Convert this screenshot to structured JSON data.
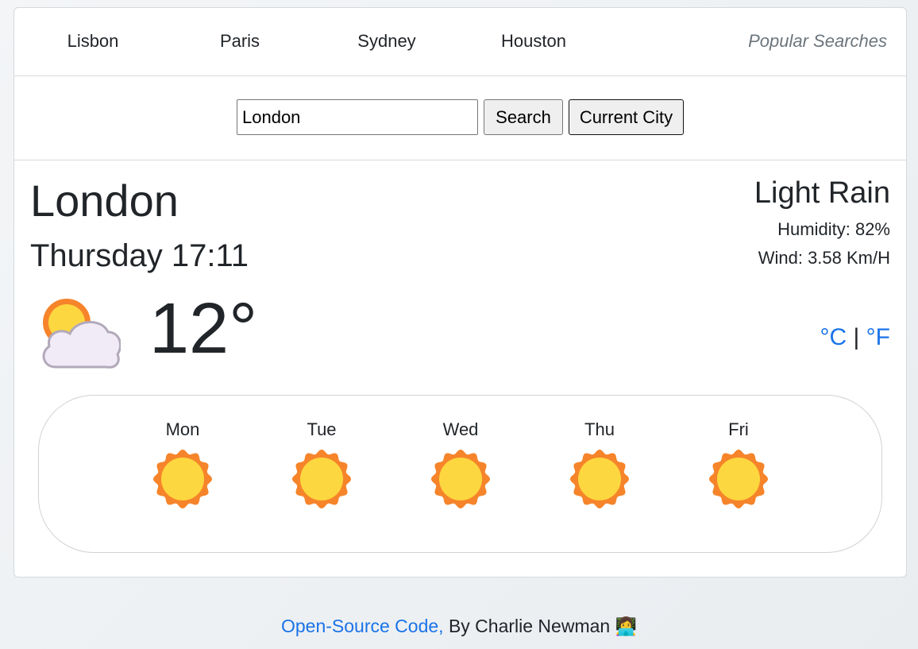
{
  "popular": {
    "cities": [
      "Lisbon",
      "Paris",
      "Sydney",
      "Houston"
    ],
    "title": "Popular Searches"
  },
  "search": {
    "value": "London",
    "search_label": "Search",
    "current_city_label": "Current City"
  },
  "current": {
    "city": "London",
    "datetime": "Thursday 17:11",
    "icon": "partly-cloudy-icon",
    "temperature": "12°",
    "description": "Light Rain",
    "humidity": "Humidity: 82%",
    "wind": "Wind: 3.58 Km/H",
    "unit_celsius": "°C",
    "unit_separator": "|",
    "unit_fahrenheit": "°F"
  },
  "forecast": [
    {
      "day": "Mon",
      "icon": "sun-icon"
    },
    {
      "day": "Tue",
      "icon": "sun-icon"
    },
    {
      "day": "Wed",
      "icon": "sun-icon"
    },
    {
      "day": "Thu",
      "icon": "sun-icon"
    },
    {
      "day": "Fri",
      "icon": "sun-icon"
    }
  ],
  "footer": {
    "link_text": "Open-Source Code,",
    "author_text": " By Charlie Newman ",
    "emoji": "👩‍💻"
  },
  "colors": {
    "link": "#1a73e8",
    "sun_outer": "#f6842a",
    "sun_inner": "#fdd73f",
    "cloud_fill": "#f1ebf7",
    "cloud_stroke": "#b2a9bb"
  }
}
